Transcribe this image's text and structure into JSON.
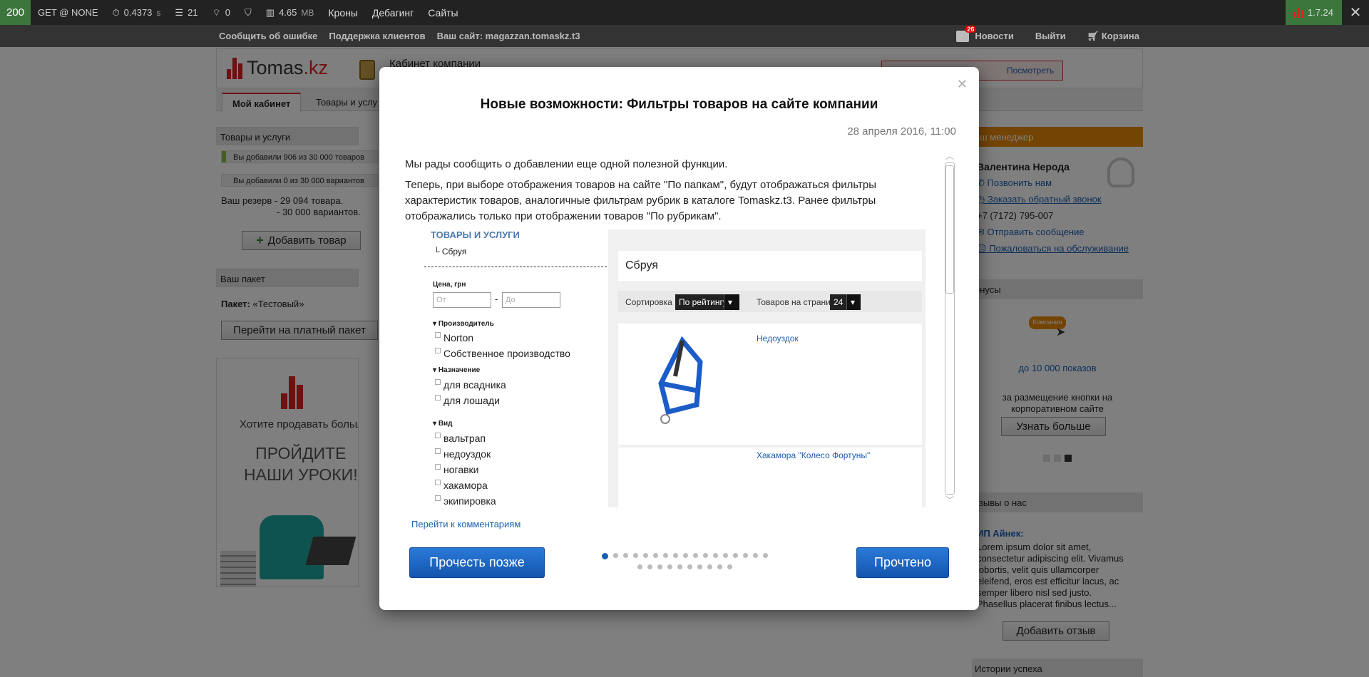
{
  "debug": {
    "status": "200",
    "method": "GET @ NONE",
    "time": "0.4373",
    "time_unit": "s",
    "db_queries": "21",
    "wifi_count": "0",
    "memory": "4.65",
    "memory_unit": "MB",
    "menu": [
      "Кроны",
      "Дебагинг",
      "Сайты"
    ],
    "version": "1.7.24"
  },
  "topnav": {
    "links": [
      "Сообщить об ошибке",
      "Поддержка клиентов",
      "Ваш сайт: magazzan.tomaskz.t3"
    ],
    "news": "Новости",
    "news_count": "26",
    "logout": "Выйти",
    "cart": "Корзина"
  },
  "header": {
    "logo_text": "Tomas",
    "logo_domain": ".kz",
    "cabinet": "Кабинет компании",
    "alert_link": "Посмотреть"
  },
  "tabs": [
    "Мой кабинет",
    "Товары и услу"
  ],
  "left": {
    "products_title": "Товары и услуги",
    "added_products": "Вы добавили 906 из 30 000 товаров",
    "added_variants": "Вы добавили 0 из 30 000 вариантов",
    "reserve1": "Ваш резерв - 29 094 товара.",
    "reserve2": "- 30 000 вариантов.",
    "add_product": "Добавить товар",
    "package_title": "Ваш пакет",
    "package_label": "Пакет:",
    "package_name": "«Тестовый»",
    "paid_btn": "Перейти на платный пакет",
    "promo_q": "Хотите продавать больше?",
    "promo_cta1": "ПРОЙДИТЕ",
    "promo_cta2": "НАШИ УРОКИ!"
  },
  "right": {
    "manager_title": "аш менеджер",
    "manager_name": "Валентина Нерода",
    "call_us": "Позвонить нам",
    "callback": "Заказать обратный звонок",
    "phone": "+7 (7172) 795-007",
    "send_msg": "Отправить сообщение",
    "complain": "Пожаловаться на обслуживание",
    "bonus_title": "онусы",
    "bonus_badge": "Компания",
    "bonus_line": "до 10 000 показов",
    "bonus_desc1": "за размещение кнопки на",
    "bonus_desc2": "корпоративном сайте",
    "learn_more": "Узнать больше",
    "reviews_title": "тзывы о нас",
    "review_author": "ИП Айнек:",
    "review_lines": [
      "Lorem ipsum dolor sit amet,",
      "consectetur adipiscing elit. Vivamus",
      "lobortis, velit quis ullamcorper",
      "eleifend, eros est efficitur lacus, ac",
      "semper libero nisl sed justo.",
      "Phasellus placerat finibus lectus..."
    ],
    "add_review": "Добавить отзыв",
    "stories_title": "Истории успеха"
  },
  "modal": {
    "title": "Новые возможности: Фильтры товаров на сайте компании",
    "date": "28 апреля 2016, 11:00",
    "p1": "Мы рады сообщить о добавлении еще одной полезной функции.",
    "p2": "Теперь, при выборе отображения товаров на сайте \"По папкам\", будут отображаться фильтры характеристик товаров, аналогичные фильтрам рубрик в каталоге Tomaskz.t3. Ранее фильтры отображались только при отображении товаров \"По рубрикам\".",
    "comments_link": "Перейти к комментариям",
    "later_btn": "Прочесть позже",
    "read_btn": "Прочтено",
    "dots_row1": 17,
    "dots_row2": 10,
    "active_dot": 1
  },
  "shot": {
    "cat_title": "ТОВАРЫ И УСЛУГИ",
    "subcat": "Сбруя",
    "price": "Цена, грн",
    "from": "От",
    "to": "До",
    "producer": "Производитель",
    "producers": [
      "Norton",
      "Собственное производство"
    ],
    "purpose": "Назначение",
    "purposes": [
      "для всадника",
      "для лошади"
    ],
    "kind": "Вид",
    "kinds": [
      "вальтрап",
      "недоуздок",
      "ногавки",
      "хакамора",
      "экипировка"
    ],
    "heading": "Сбруя",
    "sort_label": "Сортировка",
    "sort_value": "По рейтингу",
    "per_page_label": "Товаров на странице",
    "per_page_value": "24",
    "product1": "Недоуздок",
    "product2": "Хакамора \"Колесо Фортуны\""
  },
  "colors": {
    "accent": "#1a5fb4",
    "brand": "#d22222",
    "orange": "#e8880b"
  }
}
